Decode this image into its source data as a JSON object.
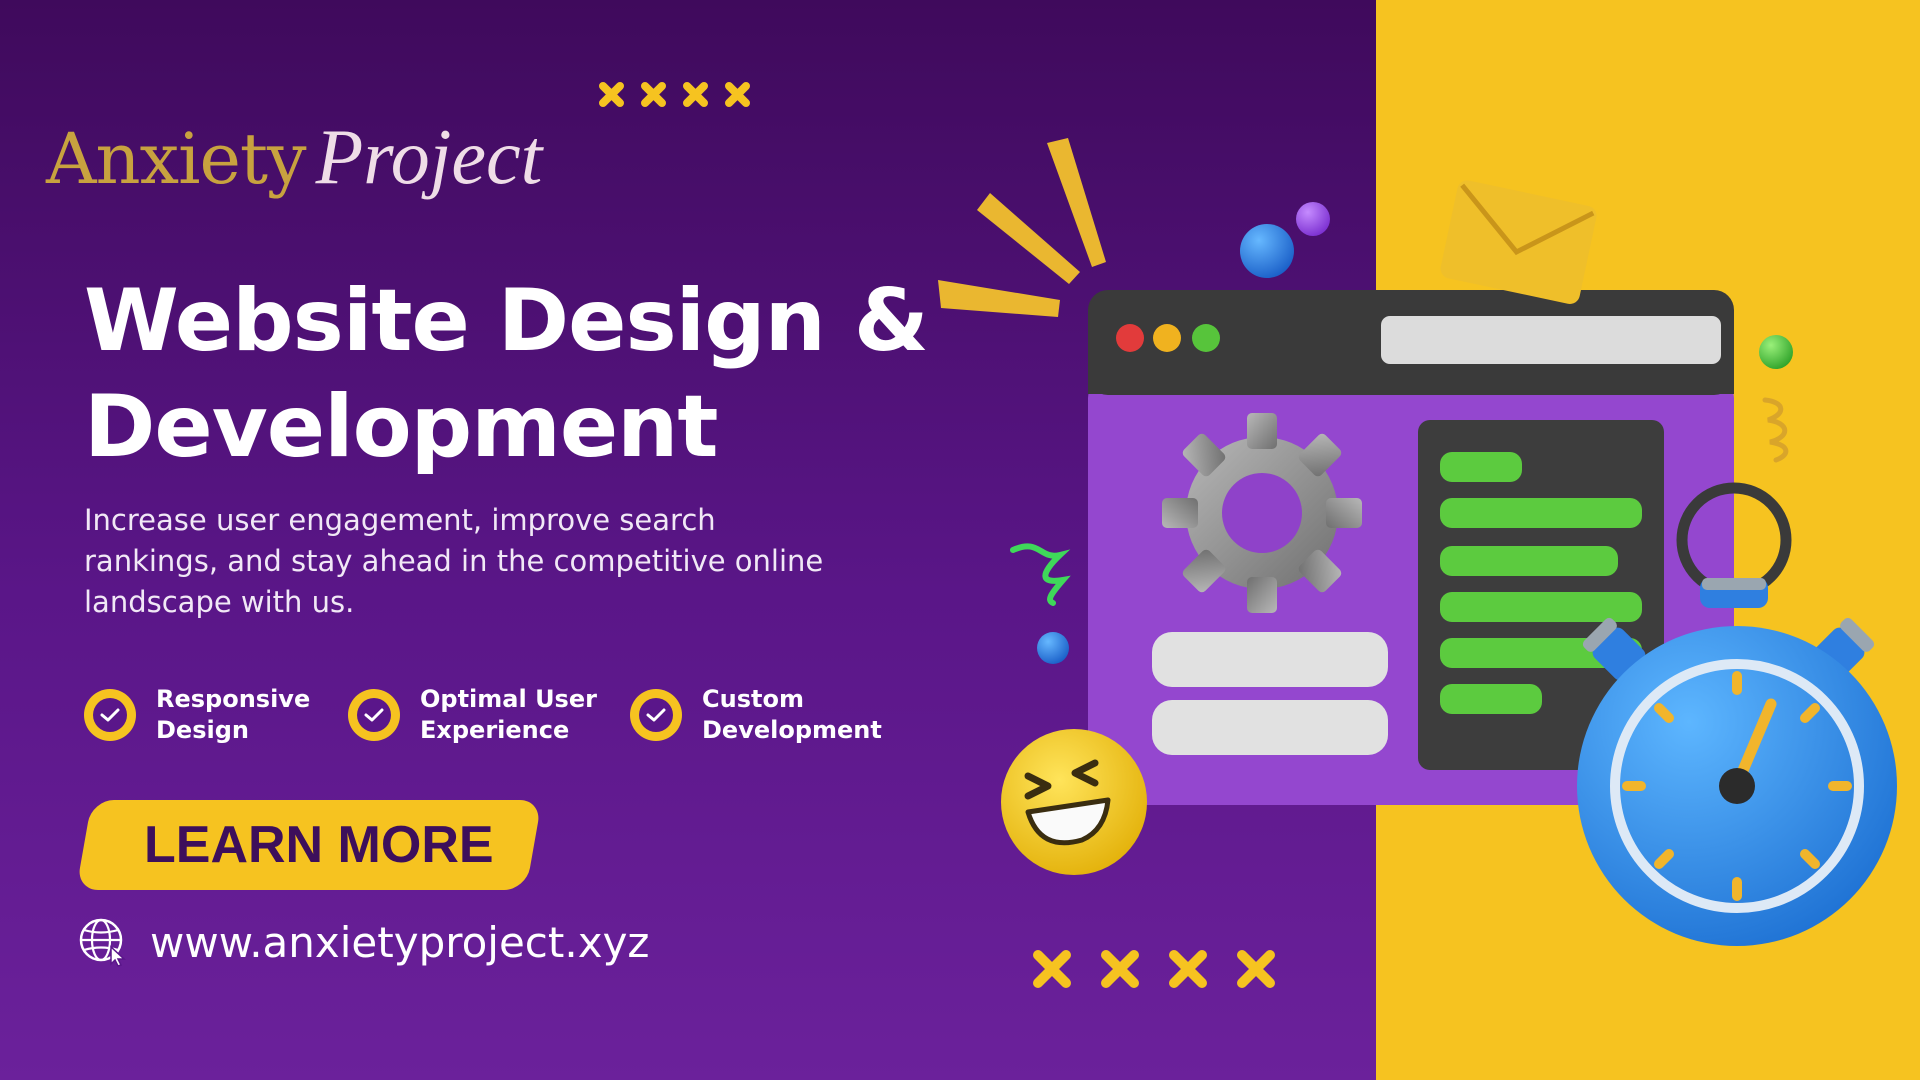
{
  "brand": {
    "word1": "Anxiety",
    "word2": "Project"
  },
  "headline": {
    "line1": "Website Design &",
    "line2": "Development"
  },
  "subtitle": "Increase user engagement, improve search rankings, and stay ahead in the competitive online landscape with us.",
  "features": [
    {
      "line1": "Responsive",
      "line2": "Design"
    },
    {
      "line1": "Optimal User",
      "line2": "Experience"
    },
    {
      "line1": "Custom",
      "line2": "Development"
    }
  ],
  "cta": {
    "label": "LEARN MORE"
  },
  "website": {
    "url": "www.anxietyproject.xyz"
  },
  "colors": {
    "purple": "#4d1077",
    "yellow": "#f6c320",
    "white": "#ffffff",
    "gold": "#c8a23f",
    "green": "#5ccb3f",
    "blue": "#2f8fe0"
  },
  "icons": [
    "check-circle-icon",
    "globe-cursor-icon",
    "gear-icon",
    "stopwatch-icon",
    "envelope-icon",
    "laughing-emoji-icon",
    "cross-mark-icon"
  ]
}
